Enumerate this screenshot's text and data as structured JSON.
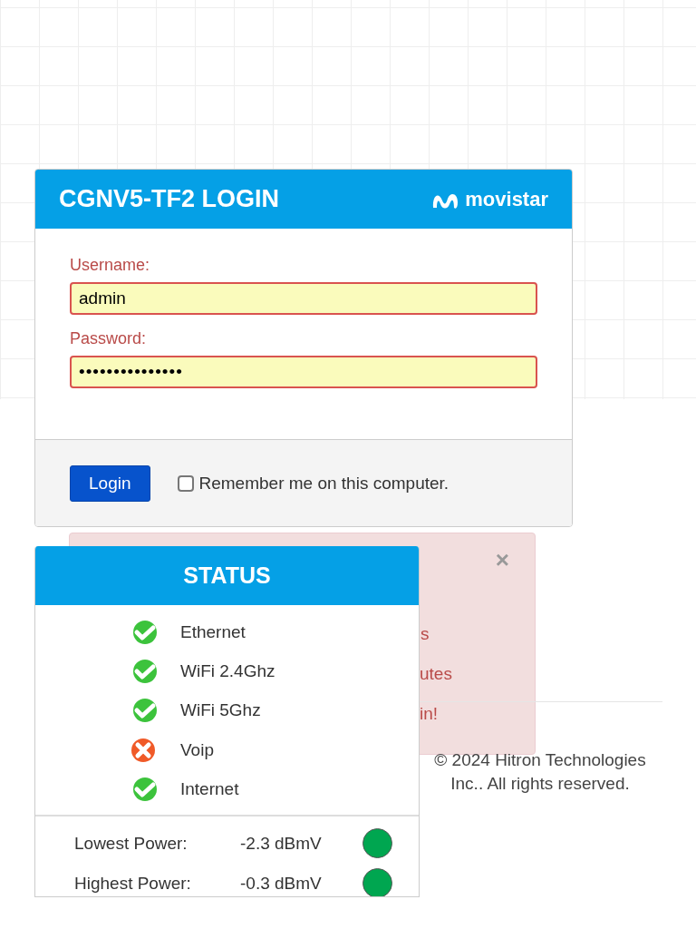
{
  "login": {
    "title": "CGNV5-TF2 LOGIN",
    "brand": "movistar",
    "fields": [
      {
        "label": "Username:",
        "value": "admin"
      },
      {
        "label": "Password:",
        "value": "•••••••••••••••"
      }
    ],
    "button": "Login",
    "remember": {
      "label": "Remember me on this computer.",
      "checked": false
    }
  },
  "alert": {
    "close": "×",
    "lines": [
      "s",
      "utes",
      "in!"
    ]
  },
  "status": {
    "title": "STATUS",
    "items": [
      {
        "label": "Ethernet",
        "ok": true
      },
      {
        "label": "WiFi 2.4Ghz",
        "ok": true
      },
      {
        "label": "WiFi 5Ghz",
        "ok": true
      },
      {
        "label": "Voip",
        "ok": false
      },
      {
        "label": "Internet",
        "ok": true
      }
    ],
    "power": [
      {
        "label": "Lowest Power:",
        "value": "-2.3 dBmV",
        "color": "#00a650"
      },
      {
        "label": "Highest Power:",
        "value": "-0.3 dBmV",
        "color": "#00a650"
      }
    ]
  },
  "footer": "© 2024 Hitron Technologies Inc.. All rights reserved."
}
